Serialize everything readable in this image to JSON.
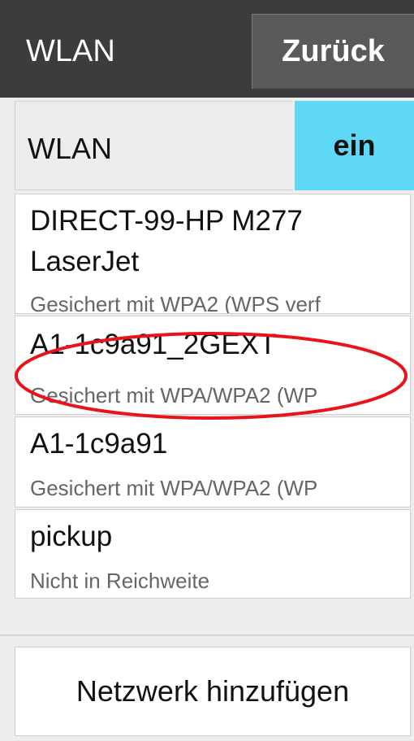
{
  "header": {
    "title": "WLAN",
    "back_label": "Zurück"
  },
  "wlan_toggle": {
    "label": "WLAN",
    "state": "ein",
    "state_color": "#5fd7f7"
  },
  "networks": [
    {
      "name_line1": "DIRECT-99-HP M277",
      "name_line2": "LaserJet",
      "status": "Gesichert mit WPA2 (WPS verf"
    },
    {
      "name_line1": "A1-1c9a91_2GEXT",
      "status": "Gesichert mit WPA/WPA2 (WP"
    },
    {
      "name_line1": "A1-1c9a91",
      "status": "Gesichert mit WPA/WPA2 (WP"
    },
    {
      "name_line1": "pickup",
      "status": "Nicht in Reichweite"
    }
  ],
  "add_network_label": "Netzwerk hinzufügen",
  "highlight_color": "#e8141a"
}
